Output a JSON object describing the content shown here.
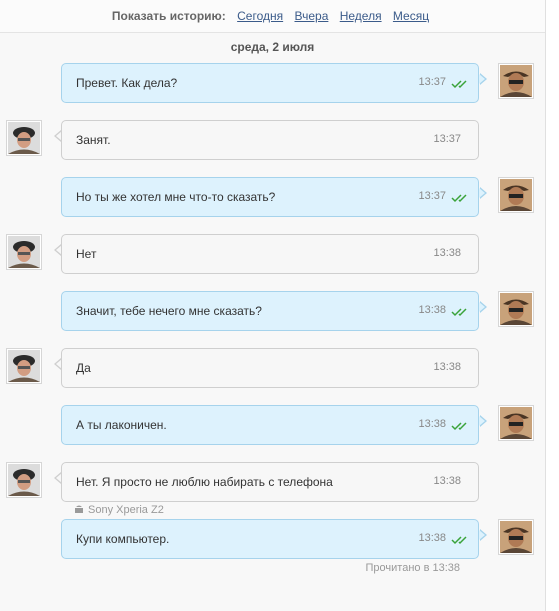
{
  "history": {
    "label": "Показать историю:",
    "links": [
      "Сегодня",
      "Вчера",
      "Неделя",
      "Месяц"
    ]
  },
  "date_divider": "среда, 2 июля",
  "messages": [
    {
      "dir": "out",
      "text": "Превет. Как дела?",
      "time": "13:37"
    },
    {
      "dir": "in",
      "text": "Занят.",
      "time": "13:37"
    },
    {
      "dir": "out",
      "text": "Но ты же хотел мне что-то сказать?",
      "time": "13:37"
    },
    {
      "dir": "in",
      "text": "Нет",
      "time": "13:38"
    },
    {
      "dir": "out",
      "text": "Значит, тебе нечего мне сказать?",
      "time": "13:38"
    },
    {
      "dir": "in",
      "text": "Да",
      "time": "13:38"
    },
    {
      "dir": "out",
      "text": "А ты лаконичен.",
      "time": "13:38"
    },
    {
      "dir": "in",
      "text": "Нет. Я просто не люблю набирать с телефона",
      "time": "13:38"
    },
    {
      "dir": "out",
      "text": "Купи компьютер.",
      "time": "13:38"
    }
  ],
  "device_label": "Sony Xperia Z2",
  "read_status": "Прочитано в 13:38",
  "colors": {
    "outgoing_bubble": "#ddf2fd",
    "incoming_bubble": "#f7f7f7",
    "link": "#3b5b8a",
    "check": "#3aa33a"
  },
  "icons": {
    "outgoing_status": "double-check-icon",
    "device": "android-icon",
    "avatar": "user-avatar"
  }
}
